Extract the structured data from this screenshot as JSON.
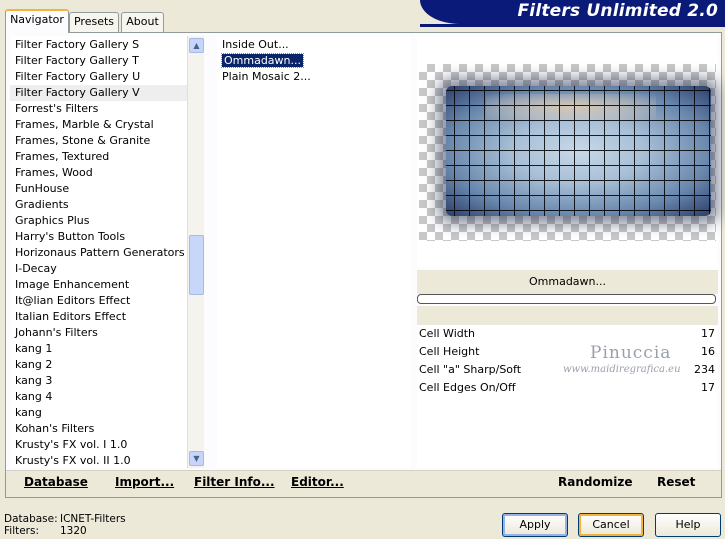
{
  "header": {
    "title": "Filters Unlimited 2.0"
  },
  "tabs": [
    {
      "label": "Navigator",
      "active": true
    },
    {
      "label": "Presets",
      "active": false
    },
    {
      "label": "About",
      "active": false
    }
  ],
  "categories": [
    "Filter Factory Gallery S",
    "Filter Factory Gallery T",
    "Filter Factory Gallery U",
    "Filter Factory Gallery V",
    "Forrest's Filters",
    "Frames, Marble & Crystal",
    "Frames, Stone & Granite",
    "Frames, Textured",
    "Frames, Wood",
    "FunHouse",
    "Gradients",
    "Graphics Plus",
    "Harry's Button Tools",
    "Horizonaus Pattern Generators",
    "I-Decay",
    "Image Enhancement",
    "It@lian Editors Effect",
    "Italian Editors Effect",
    "Johann's Filters",
    "kang 1",
    "kang 2",
    "kang 3",
    "kang 4",
    "kang",
    "Kohan's Filters",
    "Krusty's FX vol. I 1.0",
    "Krusty's FX vol. II 1.0"
  ],
  "selected_category": "Filter Factory Gallery V",
  "filters": [
    "Inside Out...",
    "Ommadawn...",
    "Plain Mosaic 2..."
  ],
  "selected_filter": "Ommadawn...",
  "preview": {
    "filter_name": "Ommadawn...",
    "progress": 0
  },
  "params": [
    {
      "label": "Cell Width",
      "value": "17"
    },
    {
      "label": "Cell Height",
      "value": "16"
    },
    {
      "label": "Cell \"a\" Sharp/Soft",
      "value": "234"
    },
    {
      "label": "Cell Edges On/Off",
      "value": "17"
    }
  ],
  "watermark": {
    "name": "Pinuccia",
    "url": "www.maidiregrafica.eu"
  },
  "toolbar": {
    "database": "Database",
    "import": "Import...",
    "filter_info": "Filter Info...",
    "editor": "Editor...",
    "randomize": "Randomize",
    "reset": "Reset"
  },
  "status": {
    "database_label": "Database:",
    "database_value": "ICNET-Filters",
    "filters_label": "Filters:",
    "filters_value": "1320"
  },
  "buttons": {
    "apply": "Apply",
    "cancel": "Cancel",
    "help": "Help"
  },
  "colors": {
    "banner": "#0a1a78",
    "selection": "#0a246a",
    "focus": "#f4b43c"
  },
  "icons": {
    "scroll_up": "chevron-up-icon",
    "scroll_down": "chevron-down-icon"
  }
}
